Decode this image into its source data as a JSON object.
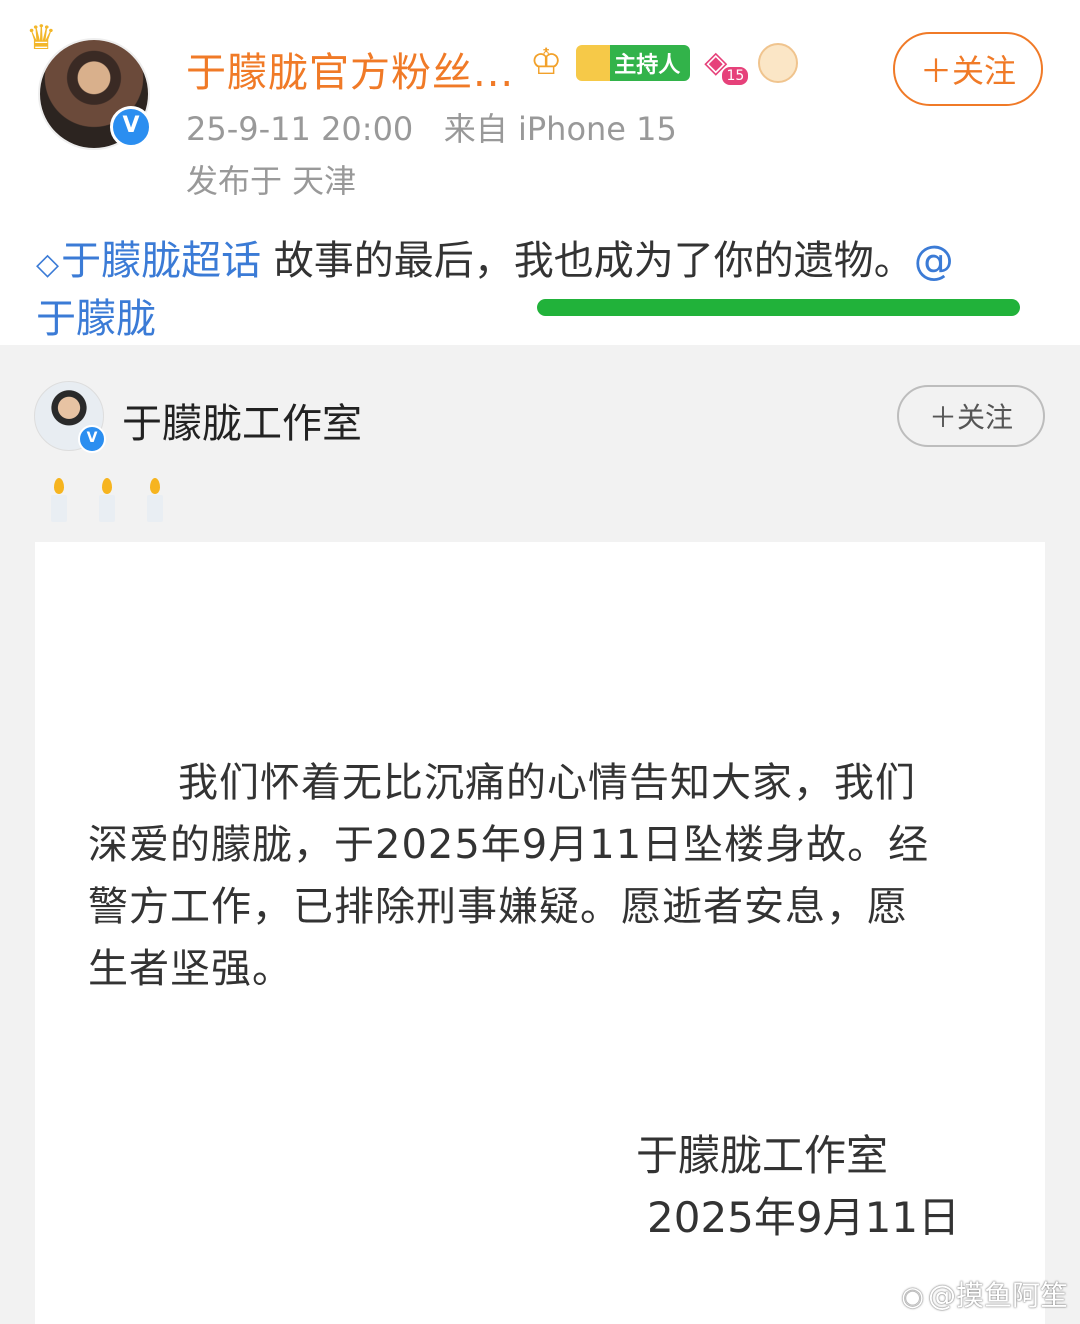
{
  "post": {
    "user_name": "于朦胧官方粉丝...",
    "host_badge": "主持人",
    "gem_level": "15",
    "follow_label": "＋关注",
    "timestamp": "25-9-11 20:00",
    "source": "来自 iPhone 15",
    "location": "发布于 天津",
    "topic": "于朦胧超话",
    "text": "故事的最后，我也成为了你的遗物。",
    "mention_at": "@",
    "mention_name": "于朦胧"
  },
  "repost": {
    "user_name": "于朦胧工作室",
    "follow_label": "＋关注",
    "notice": {
      "lines": [
        "我们怀着无比沉痛的心情告知大家，我们",
        "深爱的朦胧，于2025年9月11日坠楼身故。经",
        "警方工作，已排除刑事嫌疑。愿逝者安息，愿",
        "生者坚强。"
      ],
      "signature": "于朦胧工作室",
      "date": "2025年9月11日"
    }
  },
  "watermark": "@摸鱼阿笙",
  "colors": {
    "accent_orange": "#f07a27",
    "link_blue": "#3b7bd6",
    "highlight_green": "#21b23a",
    "verified_blue": "#2b8ef0"
  },
  "icons": [
    "crown-icon",
    "verified-icon",
    "host-badge-icon",
    "gem-icon",
    "mascot-icon",
    "topic-diamond-icon",
    "candle-icon",
    "weibo-logo-icon"
  ]
}
